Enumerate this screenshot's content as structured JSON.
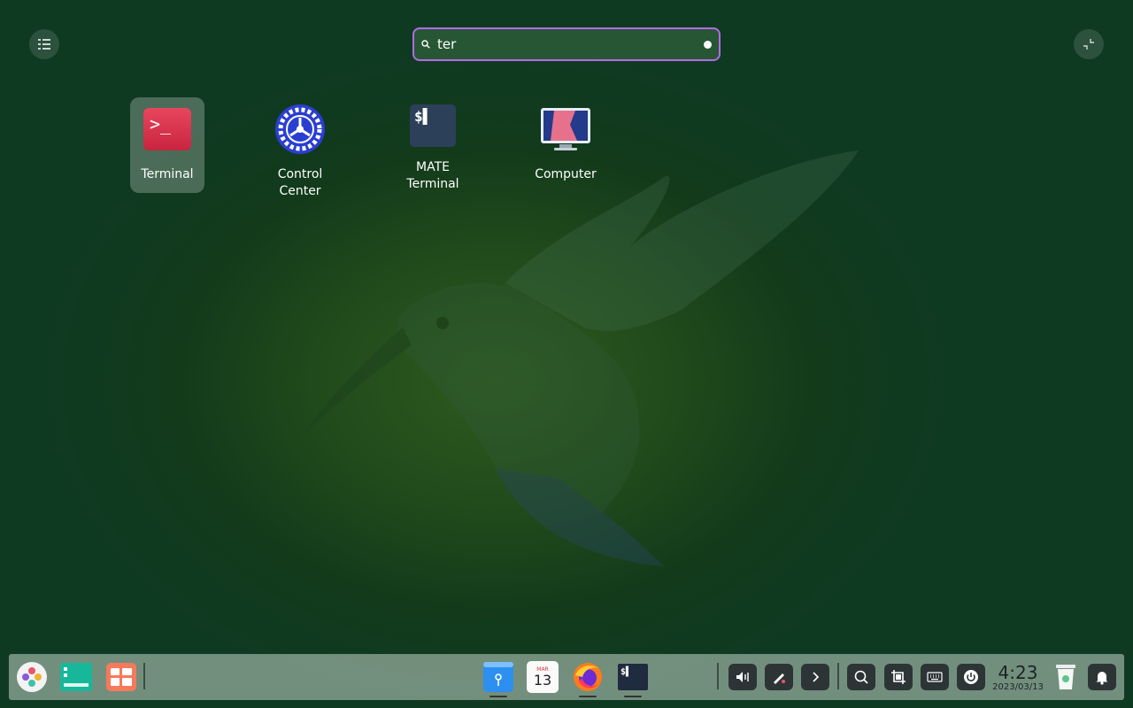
{
  "search": {
    "query": "ter",
    "placeholder": ""
  },
  "top_buttons": {
    "list_icon": "list-view-icon",
    "collapse_icon": "collapse-icon"
  },
  "apps": [
    {
      "label": "Terminal",
      "icon": "terminal-icon",
      "selected": true
    },
    {
      "label": "Control\nCenter",
      "icon": "control-center-icon",
      "selected": false
    },
    {
      "label": "MATE\nTerminal",
      "icon": "mate-terminal-icon",
      "selected": false
    },
    {
      "label": "Computer",
      "icon": "computer-icon",
      "selected": false
    }
  ],
  "dock": {
    "left_apps": [
      "launcher-icon",
      "multitasking-icon",
      "workspace-icon"
    ],
    "center_apps": [
      "file-manager-icon",
      "calendar-icon",
      "firefox-icon",
      "terminal-icon"
    ],
    "calendar": {
      "month": "MAR",
      "day": "13"
    },
    "mate_terminal_glyph": "$▌",
    "terminal_glyph": ">_",
    "tray": [
      "volume-icon",
      "pen-icon",
      "chevron-right-icon",
      "search-icon",
      "screenshot-icon",
      "keyboard-icon",
      "power-icon"
    ],
    "clock": {
      "time": "4:23",
      "date": "2023/03/13"
    },
    "trash_icon": "trash-icon",
    "notification_icon": "bell-icon"
  },
  "colors": {
    "accent": "#b46ae6",
    "terminal_red": "#e0334f",
    "dock_button": "#2d3436"
  }
}
